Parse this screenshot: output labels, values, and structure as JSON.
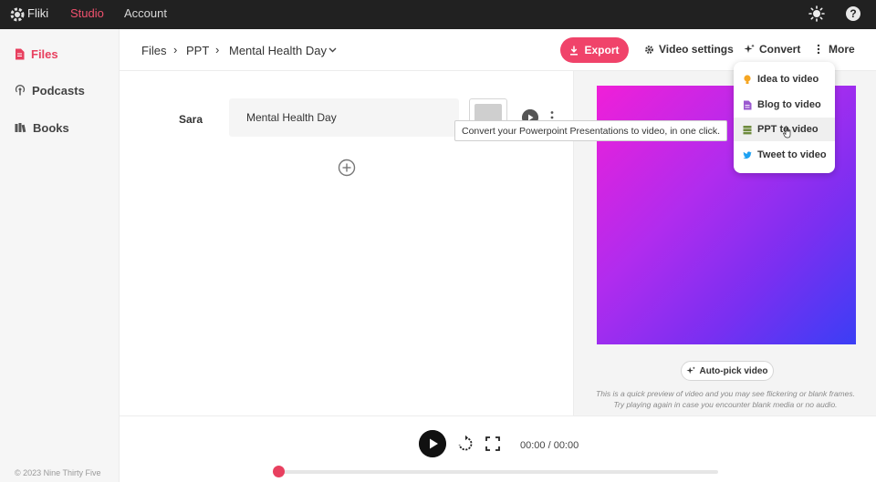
{
  "topbar": {
    "brand": "Fliki",
    "nav": [
      {
        "label": "Studio",
        "active": true
      },
      {
        "label": "Account",
        "active": false
      }
    ],
    "accent_color": "#f0516e"
  },
  "sidebar": {
    "items": [
      {
        "label": "Files",
        "icon": "file-icon",
        "active": true
      },
      {
        "label": "Podcasts",
        "icon": "podcast-icon",
        "active": false
      },
      {
        "label": "Books",
        "icon": "books-icon",
        "active": false
      }
    ],
    "copyright": "© 2023 Nine Thirty Five"
  },
  "header": {
    "breadcrumb": [
      "Files",
      "PPT",
      "Mental Health Day"
    ],
    "export_label": "Export",
    "video_settings_label": "Video settings",
    "convert_label": "Convert",
    "more_label": "More"
  },
  "editor": {
    "speaker": "Sara",
    "scene_text": "Mental Health Day"
  },
  "tooltip": "Convert your Powerpoint Presentations to video, in one click.",
  "convert_menu": {
    "items": [
      {
        "label": "Idea to video",
        "icon": "idea-icon",
        "color": "#f5a623"
      },
      {
        "label": "Blog to video",
        "icon": "blog-icon",
        "color": "#9b59d0"
      },
      {
        "label": "PPT to video",
        "icon": "ppt-icon",
        "color": "#6e8b3d",
        "hover": true
      },
      {
        "label": "Tweet to video",
        "icon": "twitter-icon",
        "color": "#1da1f2"
      }
    ]
  },
  "preview": {
    "autopick_label": "Auto-pick video",
    "note_line1": "This is a quick preview of video and you may see flickering or blank frames.",
    "note_line2": "Try playing again in case you encounter blank media or no audio."
  },
  "player": {
    "time": "00:00 / 00:00",
    "progress": 0
  }
}
